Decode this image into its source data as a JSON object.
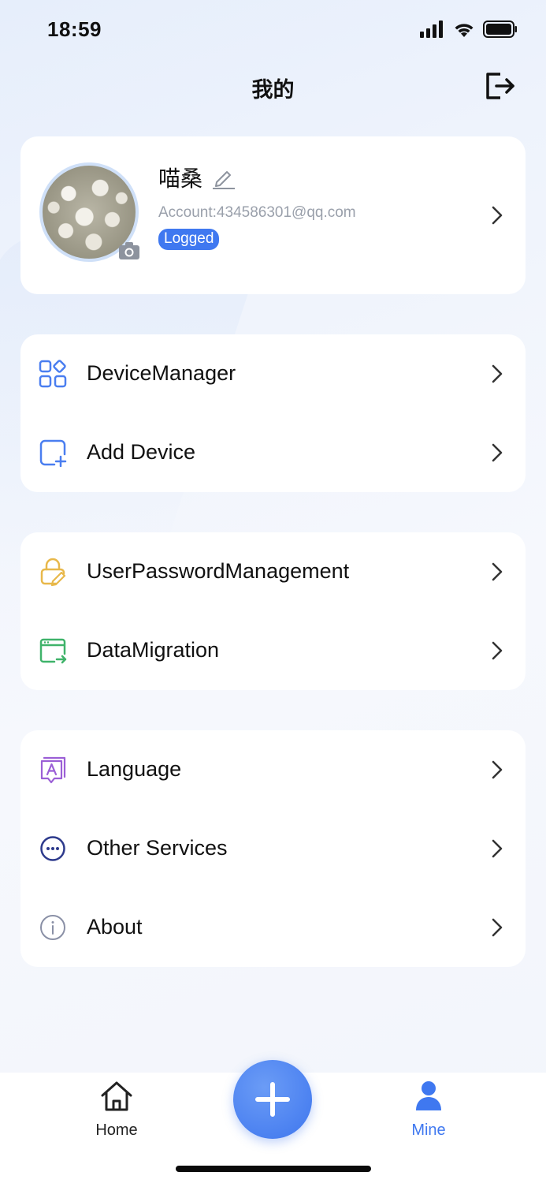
{
  "status_bar": {
    "time": "18:59"
  },
  "header": {
    "title": "我的"
  },
  "profile": {
    "name": "喵桑",
    "account": "Account:434586301@qq.com",
    "status": "Logged"
  },
  "groups": [
    {
      "items": [
        {
          "label": "DeviceManager",
          "icon": "grid-apps-icon",
          "color": "#4a7ef0"
        },
        {
          "label": "Add Device",
          "icon": "add-device-icon",
          "color": "#4a7ef0"
        }
      ]
    },
    {
      "items": [
        {
          "label": "UserPasswordManagement",
          "icon": "lock-edit-icon",
          "color": "#e8b84a"
        },
        {
          "label": "DataMigration",
          "icon": "data-migration-icon",
          "color": "#3fb36a"
        }
      ]
    },
    {
      "items": [
        {
          "label": "Language",
          "icon": "language-icon",
          "color": "#9b5fd6"
        },
        {
          "label": "Other Services",
          "icon": "more-services-icon",
          "color": "#2d3a8c"
        },
        {
          "label": "About",
          "icon": "info-icon",
          "color": "#8a90a6"
        }
      ]
    }
  ],
  "tabbar": {
    "home_label": "Home",
    "mine_label": "Mine",
    "accent": "#3f78f0"
  }
}
